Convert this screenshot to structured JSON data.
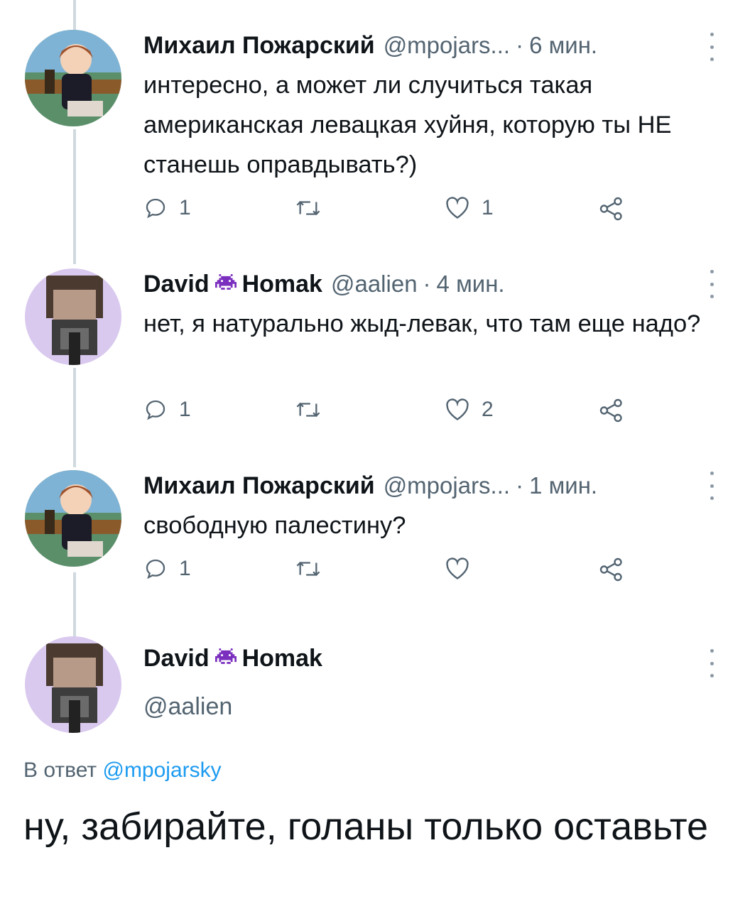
{
  "tweets": [
    {
      "author": "Михаил Пожарский",
      "handle": "@mpojars...",
      "time": "6 мин.",
      "text": "интересно, а может ли случиться такая американская левацкая хуйня, которую ты НЕ станешь оправдывать?)",
      "replies": "1",
      "retweets": "",
      "likes": "1"
    },
    {
      "author": "David",
      "author_suffix": "Homak",
      "handle": "@aalien",
      "time": "4 мин.",
      "text": "нет, я натурально жыд-левак, что там еще надо?",
      "replies": "1",
      "retweets": "",
      "likes": "2"
    },
    {
      "author": "Михаил Пожарский",
      "handle": "@mpojars...",
      "time": "1 мин.",
      "text": "свободную палестину?",
      "replies": "1",
      "retweets": "",
      "likes": ""
    }
  ],
  "main_tweet": {
    "author": "David",
    "author_suffix": "Homak",
    "handle": "@aalien",
    "reply_prefix": "В ответ",
    "reply_to": "@mpojarsky",
    "text": "ну, забирайте, голаны только оставьте"
  },
  "icons": {
    "reply": "reply-icon",
    "retweet": "retweet-icon",
    "like": "heart-icon",
    "share": "share-icon",
    "more": "more-vertical-icon",
    "badge": "space-invader-icon"
  },
  "colors": {
    "text": "#0f1419",
    "secondary": "#536471",
    "link": "#1d9bf0",
    "thread_line": "#cfd9de",
    "badge": "#7b2fbe"
  }
}
